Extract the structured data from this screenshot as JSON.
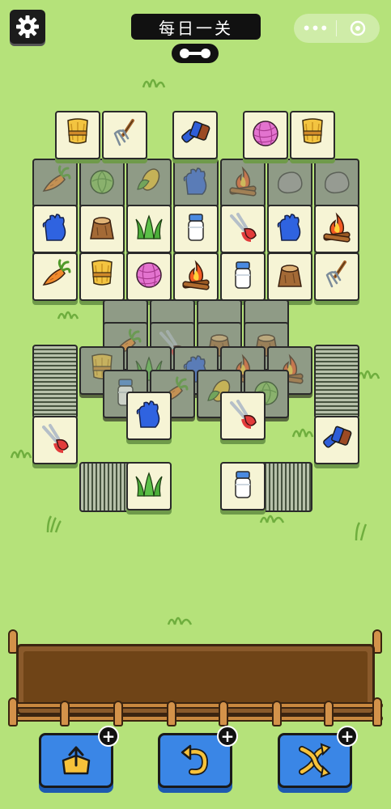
{
  "header": {
    "title": "每日一关",
    "settings_icon": "gear-icon",
    "menu_icon": "more-dots-icon",
    "close_icon": "record-circle-icon"
  },
  "colors": {
    "background": "#b5e27a",
    "tile_face": "#f6f4d5",
    "tile_covered": "#8f9b86",
    "button_blue": "#3a86e6",
    "fence_brown": "#8a5a2b"
  },
  "board": {
    "items": [
      "wheat",
      "pitchfork",
      "brush",
      "yarn",
      "wheat",
      "carrot",
      "cabbage",
      "corn",
      "glove",
      "bonfire",
      "rock",
      "cabbage",
      "glove",
      "stump",
      "grass",
      "milk",
      "shears",
      "glove",
      "bonfire",
      "carrot",
      "wheat",
      "yarn",
      "bonfire",
      "milk",
      "stump",
      "pitchfork",
      "wheat",
      "glove",
      "carrot",
      "shears",
      "grass",
      "milk",
      "brush",
      "corn",
      "cabbage"
    ]
  },
  "tray": {
    "slots_filled": 0
  },
  "buttons": [
    {
      "name": "move-out-button",
      "icon": "arrow-up-out-icon"
    },
    {
      "name": "undo-button",
      "icon": "undo-arrow-icon"
    },
    {
      "name": "shuffle-button",
      "icon": "shuffle-icon"
    }
  ]
}
